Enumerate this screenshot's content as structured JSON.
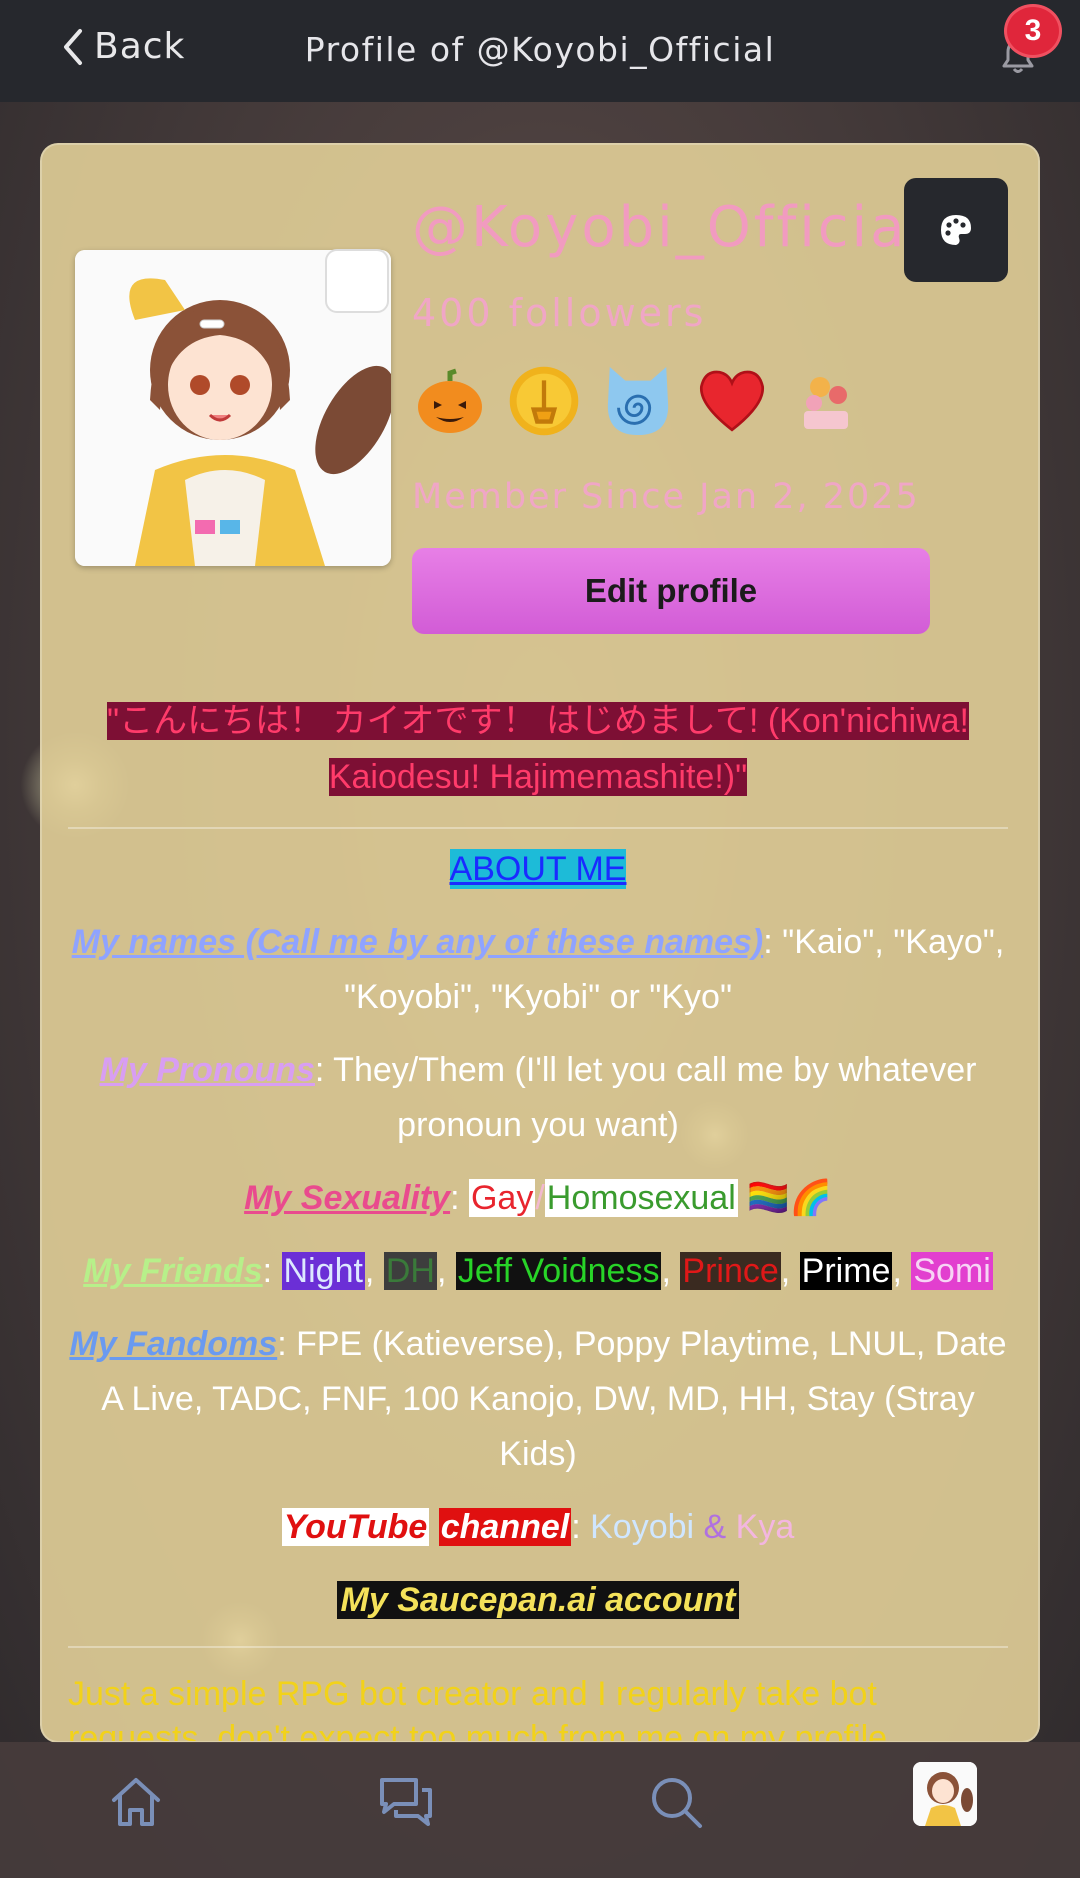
{
  "header": {
    "back_label": "Back",
    "title": "Profile of @Koyobi_Official",
    "notification_count": "3"
  },
  "profile": {
    "username": "@Koyobi_Official",
    "followers": "400 followers",
    "member_since": "Member Since Jan 2, 2025",
    "edit_label": "Edit profile",
    "badges": [
      "pumpkin-badge",
      "gold-coin-badge",
      "swirl-cat-badge",
      "heart-badge",
      "flowers-badge"
    ]
  },
  "bio": {
    "greeting": "\"こんにちは！ カイオです！ はじめまして! (Kon'nichiwa! Kaiodesu! Hajimemashite!)\"",
    "about_heading": "ABOUT ME",
    "names_label": "My names (Call me by any of these names)",
    "names_value": ": \"Kaio\", \"Kayo\", \"Koyobi\", \"Kyobi\" or \"Kyo\"",
    "pronouns_label": "My Pronouns",
    "pronouns_value": ": They/Them (I'll let you call me by whatever pronoun you want)",
    "sexuality_label": "My Sexuality",
    "sexuality_colon": ": ",
    "sexuality_gay": "Gay",
    "sexuality_slash": "/",
    "sexuality_homo": "Homosexual",
    "sexuality_emoji": " 🏳️‍🌈🌈",
    "friends_label": "My Friends",
    "friends_colon": ": ",
    "friends": [
      "Night",
      "DH",
      "Jeff Voidness",
      "Prince",
      "Prime",
      "Somi"
    ],
    "fandoms_label": "My Fandoms",
    "fandoms_value": ": FPE (Katieverse), Poppy Playtime, LNUL, Date A Live, TADC, FNF, 100 Kanojo, DW, MD, HH, Stay (Stray Kids)",
    "youtube_word": "YouTube",
    "channel_word": "channel",
    "youtube_colon": ": ",
    "youtube_name1": "Koyobi",
    "youtube_amp": " & ",
    "youtube_name2": "Kya",
    "saucepan_label": "My Saucepan.ai account",
    "description": "Just a simple RPG bot creator and I regularly take bot requests, don't expect too much from me on my profile"
  },
  "colors": {
    "card_bg": "#decc96",
    "accent_pink": "#f19bc0",
    "edit_button": "#e07ce0",
    "topbar": "#26282d",
    "badge_red": "#e0263b"
  },
  "nav": {
    "items": [
      "home-icon",
      "chat-icon",
      "search-icon",
      "profile-avatar"
    ]
  }
}
